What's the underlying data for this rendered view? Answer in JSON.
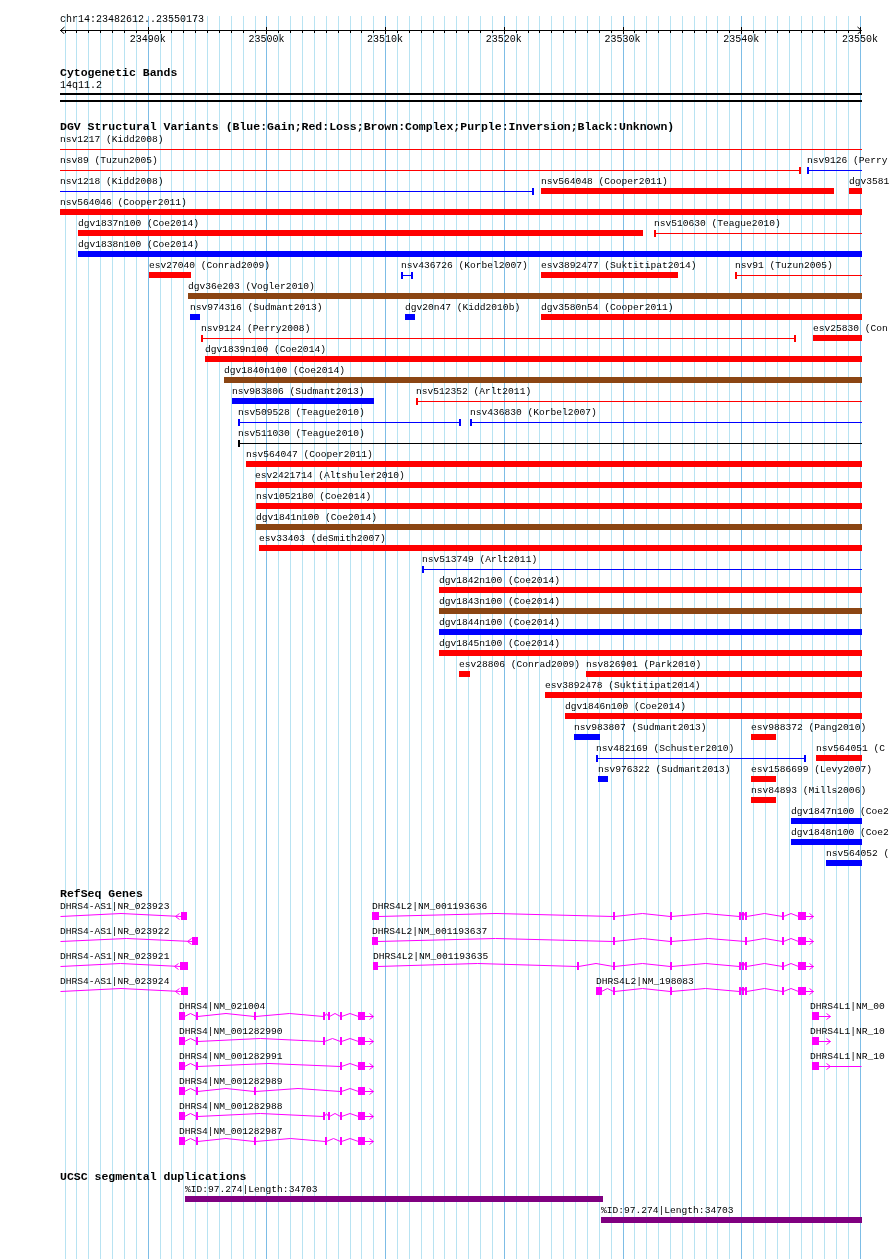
{
  "ruler": {
    "region": "chr14:23482612..23550173",
    "ticks": [
      "23490k",
      "23500k",
      "23510k",
      "23520k",
      "23530k",
      "23540k",
      "23550k"
    ]
  },
  "tracks": [
    {
      "kind": "cytoband",
      "title": "Cytogenetic Bands",
      "bands": [
        {
          "label": "14q11.2"
        }
      ]
    },
    {
      "kind": "variants",
      "title": "DGV Structural Variants (Blue:Gain;Red:Loss;Brown:Complex;Purple:Inversion;Black:Unknown)",
      "rows": [
        [
          {
            "label": "nsv1217 (Kidd2008)",
            "kind": "line",
            "color": "#ff0000"
          }
        ],
        [
          {
            "label": "nsv89 (Tuzun2005)",
            "kind": "line",
            "color": "#ff0000"
          },
          {
            "label": "nsv9126 (Perry",
            "kind": "line",
            "color": "#0000ff"
          }
        ],
        [
          {
            "label": "nsv1218 (Kidd2008)",
            "kind": "line",
            "color": "#0000ff"
          },
          {
            "label": "nsv564048 (Cooper2011)",
            "kind": "bar",
            "color": "#ff0000"
          },
          {
            "label": "dgv3581",
            "kind": "bar",
            "color": "#ff0000"
          }
        ],
        [
          {
            "label": "nsv564046 (Cooper2011)",
            "kind": "bar",
            "color": "#ff0000"
          }
        ],
        [
          {
            "label": "dgv1837n100 (Coe2014)",
            "kind": "bar",
            "color": "#ff0000"
          },
          {
            "label": "nsv510630 (Teague2010)",
            "kind": "line",
            "color": "#ff0000"
          }
        ],
        [
          {
            "label": "dgv1838n100 (Coe2014)",
            "kind": "bar",
            "color": "#0000ff"
          }
        ],
        [
          {
            "label": "esv27040 (Conrad2009)",
            "kind": "bar",
            "color": "#ff0000"
          },
          {
            "label": "nsv436726 (Korbel2007)",
            "kind": "line",
            "color": "#0000ff"
          },
          {
            "label": "esv3892477 (Suktitipat2014)",
            "kind": "bar",
            "color": "#ff0000"
          },
          {
            "label": "nsv91 (Tuzun2005)",
            "kind": "line",
            "color": "#ff0000"
          }
        ],
        [
          {
            "label": "dgv36e203 (Vogler2010)",
            "kind": "bar",
            "color": "#8b4513"
          }
        ],
        [
          {
            "label": "nsv974316 (Sudmant2013)",
            "kind": "bar",
            "color": "#0000ff"
          },
          {
            "label": "dgv20n47 (Kidd2010b)",
            "kind": "bar",
            "color": "#0000ff"
          },
          {
            "label": "dgv3580n54 (Cooper2011)",
            "kind": "bar",
            "color": "#ff0000"
          }
        ],
        [
          {
            "label": "nsv9124 (Perry2008)",
            "kind": "line",
            "color": "#ff0000"
          },
          {
            "label": "esv25830 (Con",
            "kind": "bar",
            "color": "#ff0000"
          }
        ],
        [
          {
            "label": "dgv1839n100 (Coe2014)",
            "kind": "bar",
            "color": "#ff0000"
          }
        ],
        [
          {
            "label": "dgv1840n100 (Coe2014)",
            "kind": "bar",
            "color": "#8b4513"
          }
        ],
        [
          {
            "label": "nsv983806 (Sudmant2013)",
            "kind": "bar",
            "color": "#0000ff"
          },
          {
            "label": "nsv512352 (Arlt2011)",
            "kind": "line",
            "color": "#ff0000"
          }
        ],
        [
          {
            "label": "nsv509528 (Teague2010)",
            "kind": "line",
            "color": "#0000ff"
          },
          {
            "label": "nsv436830 (Korbel2007)",
            "kind": "line",
            "color": "#0000ff"
          }
        ],
        [
          {
            "label": "nsv511030 (Teague2010)",
            "kind": "line",
            "color": "#000000"
          }
        ],
        [
          {
            "label": "nsv564047 (Cooper2011)",
            "kind": "bar",
            "color": "#ff0000"
          }
        ],
        [
          {
            "label": "esv2421714 (Altshuler2010)",
            "kind": "bar",
            "color": "#ff0000"
          }
        ],
        [
          {
            "label": "nsv1052180 (Coe2014)",
            "kind": "bar",
            "color": "#ff0000"
          }
        ],
        [
          {
            "label": "dgv1841n100 (Coe2014)",
            "kind": "bar",
            "color": "#8b4513"
          }
        ],
        [
          {
            "label": "esv33403 (deSmith2007)",
            "kind": "bar",
            "color": "#ff0000"
          }
        ],
        [
          {
            "label": "nsv513749 (Arlt2011)",
            "kind": "line",
            "color": "#0000ff"
          }
        ],
        [
          {
            "label": "dgv1842n100 (Coe2014)",
            "kind": "bar",
            "color": "#ff0000"
          }
        ],
        [
          {
            "label": "dgv1843n100 (Coe2014)",
            "kind": "bar",
            "color": "#8b4513"
          }
        ],
        [
          {
            "label": "dgv1844n100 (Coe2014)",
            "kind": "bar",
            "color": "#0000ff"
          }
        ],
        [
          {
            "label": "dgv1845n100 (Coe2014)",
            "kind": "bar",
            "color": "#ff0000"
          }
        ],
        [
          {
            "label": "esv28806 (Conrad2009)",
            "kind": "bar",
            "color": "#ff0000"
          },
          {
            "label": "nsv826901 (Park2010)",
            "kind": "bar",
            "color": "#ff0000"
          }
        ],
        [
          {
            "label": "esv3892478 (Suktitipat2014)",
            "kind": "bar",
            "color": "#ff0000"
          }
        ],
        [
          {
            "label": "dgv1846n100 (Coe2014)",
            "kind": "bar",
            "color": "#ff0000"
          }
        ],
        [
          {
            "label": "nsv983807 (Sudmant2013)",
            "kind": "bar",
            "color": "#0000ff"
          },
          {
            "label": "esv988372 (Pang2010)",
            "kind": "bar",
            "color": "#ff0000"
          }
        ],
        [
          {
            "label": "nsv482169 (Schuster2010)",
            "kind": "line",
            "color": "#0000ff"
          },
          {
            "label": "nsv564051 (C",
            "kind": "bar",
            "color": "#ff0000"
          }
        ],
        [
          {
            "label": "nsv976322 (Sudmant2013)",
            "kind": "bar",
            "color": "#0000ff"
          },
          {
            "label": "esv1586699 (Levy2007)",
            "kind": "bar",
            "color": "#ff0000"
          }
        ],
        [
          {
            "label": "nsv84893 (Mills2006)",
            "kind": "bar",
            "color": "#ff0000"
          }
        ],
        [
          {
            "label": "dgv1847n100 (Coe2",
            "kind": "bar",
            "color": "#0000ff"
          }
        ],
        [
          {
            "label": "dgv1848n100 (Coe2",
            "kind": "bar",
            "color": "#0000ff"
          }
        ],
        [
          {
            "label": "nsv564052 (",
            "kind": "bar",
            "color": "#0000ff"
          }
        ]
      ]
    },
    {
      "kind": "genes",
      "title": "RefSeq Genes",
      "rows": [
        [
          {
            "label": "DHRS4-AS1|NR_023923",
            "reverse": true
          },
          {
            "label": "DHRS4L2|NM_001193636",
            "reverse": false
          }
        ],
        [
          {
            "label": "DHRS4-AS1|NR_023922",
            "reverse": true
          },
          {
            "label": "DHRS4L2|NM_001193637",
            "reverse": false
          }
        ],
        [
          {
            "label": "DHRS4-AS1|NR_023921",
            "reverse": true
          },
          {
            "label": "DHRS4L2|NM_001193635",
            "reverse": false
          }
        ],
        [
          {
            "label": "DHRS4-AS1|NR_023924",
            "reverse": true
          },
          {
            "label": "DHRS4L2|NM_198083",
            "reverse": false
          }
        ],
        [
          {
            "label": "DHRS4|NM_021004",
            "reverse": false
          },
          {
            "label": "DHRS4L1|NM_00",
            "reverse": false
          }
        ],
        [
          {
            "label": "DHRS4|NM_001282990",
            "reverse": false
          },
          {
            "label": "DHRS4L1|NR_10",
            "reverse": false
          }
        ],
        [
          {
            "label": "DHRS4|NM_001282991",
            "reverse": false
          },
          {
            "label": "DHRS4L1|NR_10",
            "reverse": false
          }
        ],
        [
          {
            "label": "DHRS4|NM_001282989",
            "reverse": false
          }
        ],
        [
          {
            "label": "DHRS4|NM_001282988",
            "reverse": false
          }
        ],
        [
          {
            "label": "DHRS4|NM_001282987",
            "reverse": false
          }
        ]
      ]
    },
    {
      "kind": "segdups",
      "title": "UCSC segmental duplications",
      "rows": [
        [
          {
            "label": "%ID:97.274|Length:34703"
          }
        ],
        [
          {
            "label": "%ID:97.274|Length:34703"
          }
        ]
      ]
    }
  ]
}
